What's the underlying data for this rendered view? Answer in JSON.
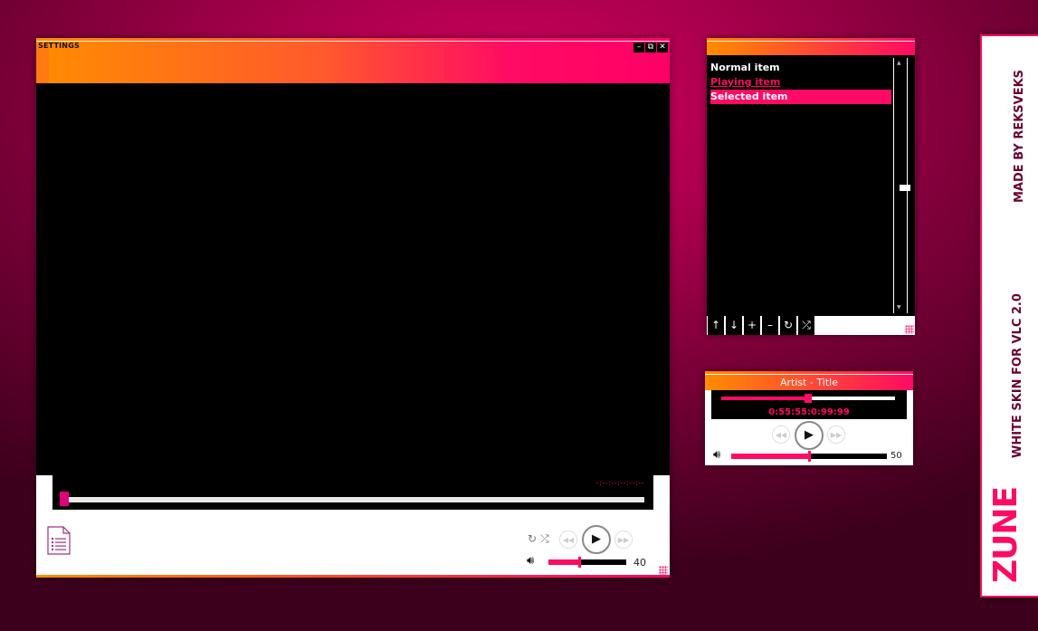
{
  "colors": {
    "accent": "#ff0a64",
    "orange": "#ff8c00",
    "background": "#a3004a"
  },
  "main_window": {
    "settings_label": "SETTINGS",
    "window_buttons": {
      "minimize": "–",
      "maximize": "⧉",
      "close": "✕"
    },
    "time_display": "-:--:--:--:--:--",
    "seek_progress": 0.01,
    "icons": {
      "playlist": "playlist-icon",
      "repeat": "repeat-icon",
      "shuffle": "shuffle-icon",
      "prev": "previous-icon",
      "play": "play-icon",
      "next": "next-icon",
      "volume": "volume-icon"
    },
    "glyphs": {
      "repeat": "↻",
      "shuffle": "⤮",
      "prev": "◀◀",
      "play": "▶",
      "next": "▶▶",
      "volume": "🔊︎"
    },
    "volume_value": "40",
    "volume_fraction": 0.4
  },
  "playlist_window": {
    "items": [
      {
        "label": "Normal item",
        "state": "normal"
      },
      {
        "label": "Playing item",
        "state": "playing"
      },
      {
        "label": "Selected item",
        "state": "selected"
      }
    ],
    "scroll_up": "▲",
    "scroll_down": "▼",
    "toolbar": {
      "up": "↑",
      "down": "↓",
      "add": "+",
      "remove": "–",
      "repeat": "↻",
      "shuffle": "⤮"
    }
  },
  "mini_player": {
    "title": "Artist - Title",
    "time": "0:55:55:0:99:99",
    "seek_progress": 0.5,
    "prev": "◀◀",
    "play": "▶",
    "next": "▶▶",
    "volume_glyph": "🔊︎",
    "volume_value": "50",
    "volume_fraction": 0.5
  },
  "brand": {
    "name": "ZUNE",
    "subtitle": "WHITE SKIN FOR VLC 2.0",
    "credit": "MADE BY REKSVEKS"
  }
}
